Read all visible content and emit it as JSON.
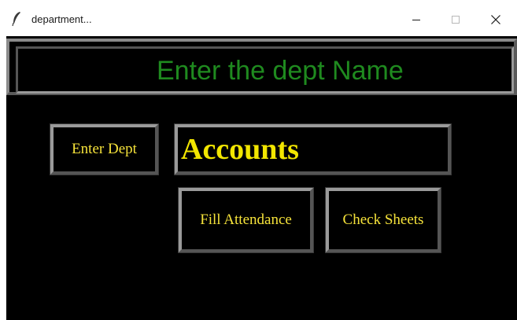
{
  "window": {
    "title": "department..."
  },
  "header": {
    "title": "Enter the dept Name"
  },
  "buttons": {
    "enter_dept": "Enter Dept",
    "fill_attendance": "Fill Attendance",
    "check_sheets": "Check Sheets"
  },
  "entry": {
    "value": "Accounts"
  },
  "colors": {
    "background": "#000000",
    "header_text": "#1f8a1f",
    "button_text": "#f5e23a",
    "entry_text": "#f2e600",
    "border": "#7c7c7c"
  },
  "icons": {
    "app": "feather-icon",
    "minimize": "minimize-icon",
    "maximize": "maximize-icon",
    "close": "close-icon"
  }
}
